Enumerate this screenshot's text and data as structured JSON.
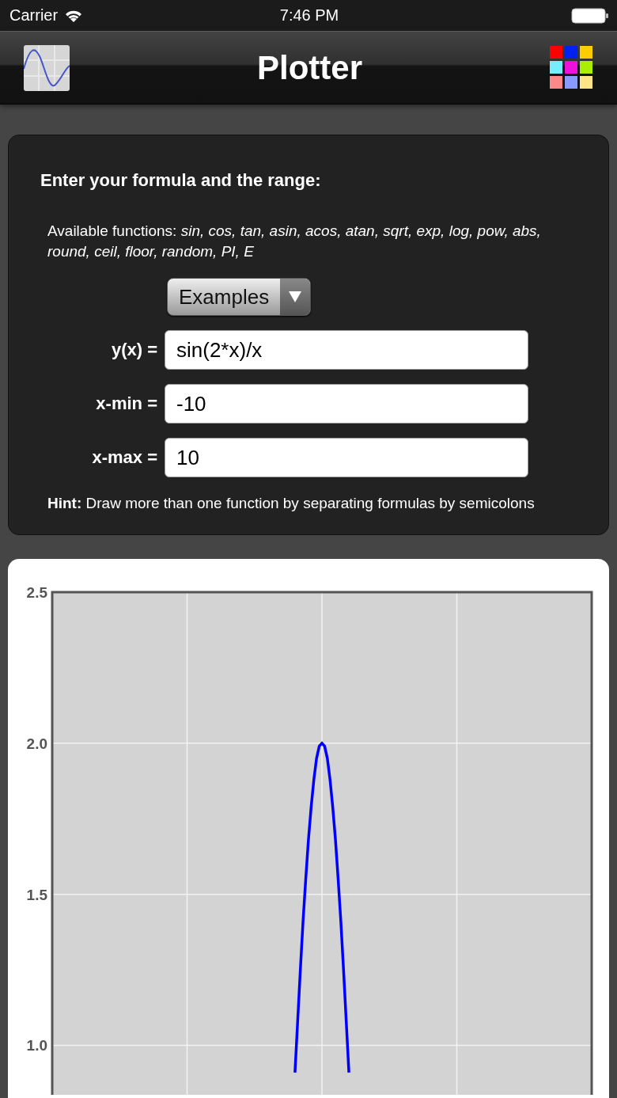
{
  "status_bar": {
    "carrier": "Carrier",
    "time": "7:46 PM"
  },
  "nav_bar": {
    "title": "Plotter"
  },
  "form": {
    "heading": "Enter your formula and the range:",
    "functions_note": "Available functions: *sin, cos, tan, asin, acos, atan, sqrt, exp, log, pow, abs, round, ceil, floor, random, PI, E*",
    "examples_button": {
      "label": "Examples"
    },
    "fields": [
      {
        "label": "y(x) =",
        "value": "sin(2*x)/x"
      },
      {
        "label": "x-min =",
        "value": "-10"
      },
      {
        "label": "x-max =",
        "value": "10"
      }
    ],
    "hint": "**Hint:** Draw more than one function by separating formulas by semicolons"
  },
  "plot": {
    "chart_data": {
      "type": "line",
      "categories": [
        null,
        null,
        null,
        null,
        null,
        null,
        null,
        null,
        null,
        null,
        null,
        null,
        null,
        null,
        null,
        null,
        null,
        null,
        null,
        null,
        null,
        null,
        null,
        null,
        null,
        null,
        null,
        null,
        null,
        null,
        null,
        null,
        null,
        null,
        null,
        null,
        null,
        null,
        null,
        null,
        null,
        null,
        null,
        null,
        null,
        null,
        null,
        null,
        null,
        null,
        null,
        null,
        null,
        null,
        null,
        null,
        null,
        null,
        null,
        null,
        null,
        null,
        null,
        null,
        null,
        null,
        null,
        null,
        null,
        null,
        null,
        null,
        null,
        null,
        null,
        null,
        null,
        null,
        null,
        null,
        null,
        null,
        null,
        null,
        null,
        null,
        null,
        null,
        null,
        null,
        null,
        null,
        null,
        null,
        null,
        null,
        null,
        null,
        null,
        null,
        null,
        null,
        null,
        null,
        null,
        null,
        null,
        null,
        null,
        null,
        null,
        null,
        null,
        null,
        null,
        null,
        null,
        null,
        null,
        null,
        null,
        null,
        null,
        null,
        null,
        null,
        null,
        null,
        null,
        null,
        null,
        null,
        null,
        null,
        null,
        null,
        null,
        null,
        null,
        null,
        null,
        null,
        null,
        null,
        null,
        null,
        null,
        null,
        null,
        null,
        null,
        null,
        null,
        null,
        null,
        null,
        null,
        null,
        null,
        null,
        null,
        null,
        null,
        null,
        null,
        null,
        null,
        null,
        null,
        null,
        null,
        null,
        null,
        null,
        null,
        null,
        null,
        null,
        null,
        null,
        null,
        null,
        null,
        null,
        null,
        null,
        null,
        null,
        null,
        null,
        null,
        null,
        null,
        null,
        null,
        null,
        null,
        null,
        null,
        null,
        null
      ],
      "series": [
        {
          "color": "#0000ff",
          "values": [
            null,
            null,
            null,
            null,
            null,
            null,
            null,
            null,
            null,
            null,
            null,
            null,
            null,
            null,
            null,
            null,
            null,
            null,
            null,
            null,
            null,
            null,
            null,
            null,
            null,
            null,
            null,
            null,
            null,
            null,
            null,
            null,
            null,
            null,
            null,
            null,
            null,
            null,
            null,
            null,
            null,
            null,
            null,
            null,
            null,
            null,
            null,
            null,
            null,
            null,
            null,
            null,
            null,
            null,
            null,
            null,
            null,
            null,
            null,
            null,
            null,
            null,
            null,
            null,
            null,
            null,
            null,
            null,
            null,
            null,
            null,
            null,
            null,
            null,
            null,
            null,
            null,
            null,
            null,
            null,
            null,
            null,
            null,
            null,
            null,
            null,
            null,
            null,
            null,
            null,
            0.91,
            1.08,
            1.25,
            1.41,
            1.55,
            1.68,
            1.79,
            1.88,
            1.95,
            1.99,
            2,
            1.99,
            1.95,
            1.88,
            1.79,
            1.68,
            1.55,
            1.41,
            1.25,
            1.08,
            0.91,
            null,
            null,
            null,
            null,
            null,
            null,
            null,
            null,
            null,
            null,
            null,
            null,
            null,
            null,
            null,
            null,
            null,
            null,
            null,
            null,
            null,
            null,
            null,
            null,
            null,
            null,
            null,
            null,
            null,
            null,
            null,
            null,
            null,
            null,
            null,
            null,
            null,
            null,
            null,
            null,
            null,
            null,
            null,
            null,
            null,
            null,
            null,
            null,
            null,
            null,
            null,
            null,
            null,
            null,
            null,
            null,
            null,
            null,
            null,
            null,
            null,
            null,
            null,
            null,
            null,
            null,
            null,
            null,
            null,
            null,
            null,
            null,
            null,
            null,
            null,
            null,
            null,
            null,
            null,
            null,
            null,
            null,
            null,
            null,
            null,
            null,
            null,
            null,
            null,
            null
          ]
        }
      ],
      "ylim": [
        0.81,
        2.5
      ],
      "yticks": [
        {
          "value": 1,
          "label": "1.0"
        },
        {
          "value": 1.5,
          "label": "1.5"
        },
        {
          "value": 2,
          "label": "2.0"
        },
        {
          "value": 2.5,
          "label": "2.5"
        }
      ],
      "grid": true
    }
  }
}
